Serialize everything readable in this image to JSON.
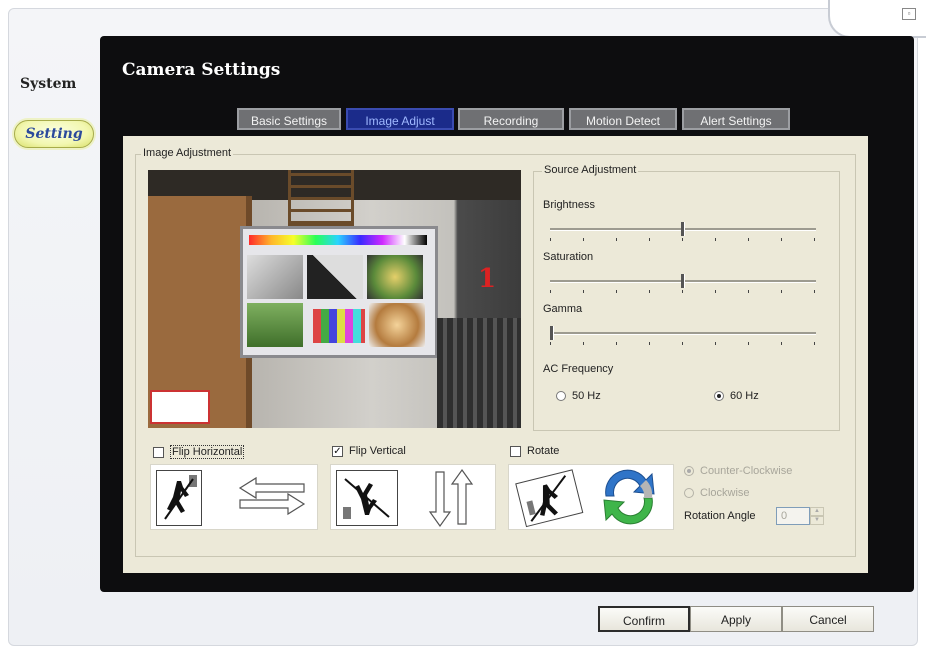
{
  "sidebar": {
    "system_label": "System",
    "setting_label": "Setting"
  },
  "window": {
    "title": "Camera Settings"
  },
  "tabs": [
    {
      "label": "Basic Settings",
      "active": false
    },
    {
      "label": "Image Adjust",
      "active": true
    },
    {
      "label": "Recording",
      "active": false
    },
    {
      "label": "Motion Detect",
      "active": false
    },
    {
      "label": "Alert Settings",
      "active": false
    }
  ],
  "image_adjustment": {
    "group_label": "Image Adjustment",
    "preview": {
      "overlay_text": "1"
    },
    "source": {
      "group_label": "Source Adjustment",
      "brightness": {
        "label": "Brightness",
        "value_fraction": 0.5
      },
      "saturation": {
        "label": "Saturation",
        "value_fraction": 0.5
      },
      "gamma": {
        "label": "Gamma",
        "value_fraction": 0.0
      },
      "ac_frequency": {
        "label": "AC Frequency",
        "options": [
          {
            "label": "50 Hz",
            "selected": false
          },
          {
            "label": "60 Hz",
            "selected": true
          }
        ]
      }
    },
    "flip_horizontal": {
      "label": "Flip Horizontal",
      "checked": false
    },
    "flip_vertical": {
      "label": "Flip Vertical",
      "checked": true
    },
    "rotate": {
      "label": "Rotate",
      "checked": false,
      "counter_clockwise": {
        "label": "Counter-Clockwise",
        "selected": true
      },
      "clockwise": {
        "label": "Clockwise",
        "selected": false
      },
      "angle": {
        "label": "Rotation Angle",
        "value": "0"
      }
    }
  },
  "buttons": {
    "confirm": "Confirm",
    "apply": "Apply",
    "cancel": "Cancel"
  },
  "colors": {
    "active_tab": "#1b2b8a",
    "panel_bg": "#ece9d8",
    "dark_bg": "#0d0d0f"
  }
}
